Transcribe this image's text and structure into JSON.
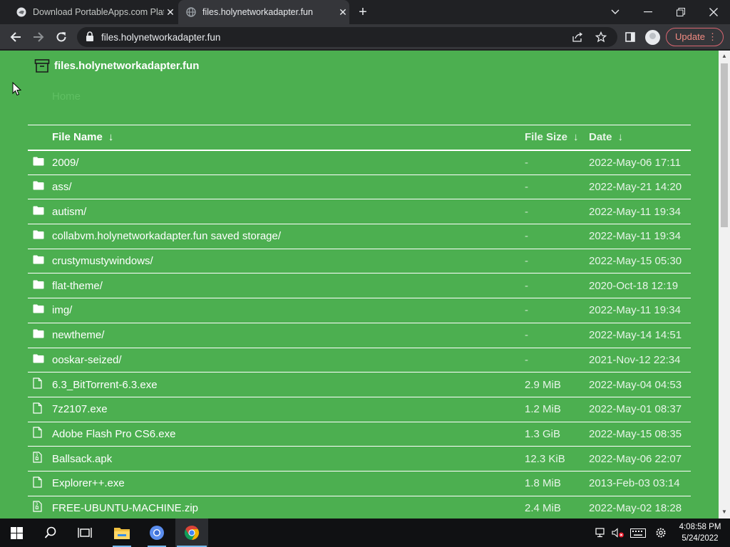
{
  "browser": {
    "tabs": [
      {
        "title": "Download PortableApps.com Platform",
        "active": false
      },
      {
        "title": "files.holynetworkadapter.fun",
        "active": true
      }
    ],
    "address": "files.holynetworkadapter.fun",
    "update_label": "Update"
  },
  "site": {
    "title": "files.holynetworkadapter.fun",
    "breadcrumb": "Home"
  },
  "table": {
    "headers": {
      "name": "File Name",
      "size": "File Size",
      "date": "Date",
      "sort_arrow": "↓"
    },
    "rows": [
      {
        "type": "folder",
        "name": "2009/",
        "size": "-",
        "date": "2022-May-06 17:11"
      },
      {
        "type": "folder",
        "name": "ass/",
        "size": "-",
        "date": "2022-May-21 14:20"
      },
      {
        "type": "folder",
        "name": "autism/",
        "size": "-",
        "date": "2022-May-11 19:34"
      },
      {
        "type": "folder",
        "name": "collabvm.holynetworkadapter.fun saved storage/",
        "size": "-",
        "date": "2022-May-11 19:34"
      },
      {
        "type": "folder",
        "name": "crustymustywindows/",
        "size": "-",
        "date": "2022-May-15 05:30"
      },
      {
        "type": "folder",
        "name": "flat-theme/",
        "size": "-",
        "date": "2020-Oct-18 12:19"
      },
      {
        "type": "folder",
        "name": "img/",
        "size": "-",
        "date": "2022-May-11 19:34"
      },
      {
        "type": "folder",
        "name": "newtheme/",
        "size": "-",
        "date": "2022-May-14 14:51"
      },
      {
        "type": "folder",
        "name": "ooskar-seized/",
        "size": "-",
        "date": "2021-Nov-12 22:34"
      },
      {
        "type": "file",
        "name": "6.3_BitTorrent-6.3.exe",
        "size": "2.9 MiB",
        "date": "2022-May-04 04:53"
      },
      {
        "type": "file",
        "name": "7z2107.exe",
        "size": "1.2 MiB",
        "date": "2022-May-01 08:37"
      },
      {
        "type": "file",
        "name": "Adobe Flash Pro CS6.exe",
        "size": "1.3 GiB",
        "date": "2022-May-15 08:35"
      },
      {
        "type": "archive",
        "name": "Ballsack.apk",
        "size": "12.3 KiB",
        "date": "2022-May-06 22:07"
      },
      {
        "type": "file",
        "name": "Explorer++.exe",
        "size": "1.8 MiB",
        "date": "2013-Feb-03 03:14"
      },
      {
        "type": "archive",
        "name": "FREE-UBUNTU-MACHINE.zip",
        "size": "2.4 MiB",
        "date": "2022-May-02 18:28"
      }
    ]
  },
  "taskbar": {
    "time": "4:08:58 PM",
    "date": "5/24/2022"
  },
  "colors": {
    "page_bg": "#4caf50",
    "update_accent": "#f28b82",
    "browser_dark": "#202124"
  }
}
